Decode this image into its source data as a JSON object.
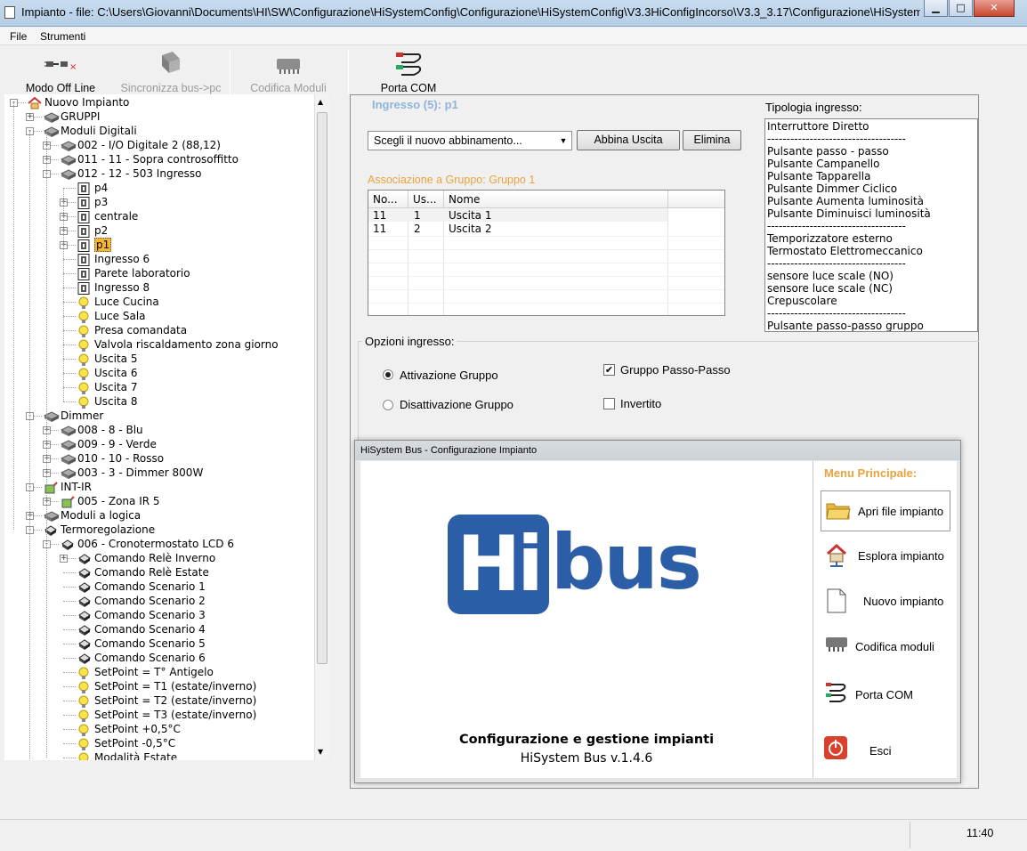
{
  "window": {
    "title": "Impianto - file: C:\\Users\\Giovanni\\Documents\\HI\\SW\\Configurazione\\HiSystemConfig\\Configurazione\\HiSystemConfig\\V3.3HiConfigIncorso\\V3.3_3.17\\Configurazione\\HiSystem"
  },
  "menu": {
    "file": "File",
    "strumenti": "Strumenti"
  },
  "toolbar": {
    "offline": "Modo Off Line",
    "sync": "Sincronizza bus->pc",
    "codifica": "Codifica Moduli",
    "porta": "Porta COM"
  },
  "tree": [
    {
      "label": "Nuovo Impianto",
      "depth": 0,
      "exp": "-",
      "icon": "house-icon"
    },
    {
      "label": "GRUPPI",
      "depth": 1,
      "exp": "+",
      "icon": "module-icon"
    },
    {
      "label": "Moduli Digitali",
      "depth": 1,
      "exp": "-",
      "icon": "module-icon"
    },
    {
      "label": "002 - I/O Digitale 2 (88,12)",
      "depth": 2,
      "exp": "+",
      "icon": "module-icon"
    },
    {
      "label": "011 - 11 - Sopra controsoffitto",
      "depth": 2,
      "exp": "+",
      "icon": "module-icon"
    },
    {
      "label": "012 - 12 - 503 Ingresso",
      "depth": 2,
      "exp": "-",
      "icon": "module-icon"
    },
    {
      "label": "p4",
      "depth": 3,
      "exp": "",
      "icon": "input-icon"
    },
    {
      "label": "p3",
      "depth": 3,
      "exp": "+",
      "icon": "input-icon"
    },
    {
      "label": "centrale",
      "depth": 3,
      "exp": "+",
      "icon": "input-icon"
    },
    {
      "label": "p2",
      "depth": 3,
      "exp": "+",
      "icon": "input-icon"
    },
    {
      "label": "p1",
      "depth": 3,
      "exp": "+",
      "icon": "input-icon",
      "selected": true
    },
    {
      "label": "Ingresso 6",
      "depth": 3,
      "exp": "",
      "icon": "input-icon"
    },
    {
      "label": "Parete laboratorio",
      "depth": 3,
      "exp": "",
      "icon": "input-icon"
    },
    {
      "label": "Ingresso 8",
      "depth": 3,
      "exp": "",
      "icon": "input-icon"
    },
    {
      "label": "Luce Cucina",
      "depth": 3,
      "exp": "",
      "icon": "bulb-icon"
    },
    {
      "label": "Luce Sala",
      "depth": 3,
      "exp": "",
      "icon": "bulb-icon"
    },
    {
      "label": "Presa comandata",
      "depth": 3,
      "exp": "",
      "icon": "bulb-icon"
    },
    {
      "label": "Valvola riscaldamento zona giorno",
      "depth": 3,
      "exp": "",
      "icon": "bulb-icon"
    },
    {
      "label": "Uscita 5",
      "depth": 3,
      "exp": "",
      "icon": "bulb-icon"
    },
    {
      "label": "Uscita 6",
      "depth": 3,
      "exp": "",
      "icon": "bulb-icon"
    },
    {
      "label": "Uscita 7",
      "depth": 3,
      "exp": "",
      "icon": "bulb-icon"
    },
    {
      "label": "Uscita 8",
      "depth": 3,
      "exp": "",
      "icon": "bulb-icon"
    },
    {
      "label": "Dimmer",
      "depth": 1,
      "exp": "-",
      "icon": "module-icon"
    },
    {
      "label": "008 - 8 - Blu",
      "depth": 2,
      "exp": "+",
      "icon": "module-icon"
    },
    {
      "label": "009 - 9 - Verde",
      "depth": 2,
      "exp": "+",
      "icon": "module-icon"
    },
    {
      "label": "010 - 10 - Rosso",
      "depth": 2,
      "exp": "+",
      "icon": "module-icon"
    },
    {
      "label": "003 - 3 - Dimmer 800W",
      "depth": 2,
      "exp": "+",
      "icon": "module-icon"
    },
    {
      "label": "INT-IR",
      "depth": 1,
      "exp": "-",
      "icon": "ir-icon"
    },
    {
      "label": "005 - Zona IR 5",
      "depth": 2,
      "exp": "+",
      "icon": "ir-icon"
    },
    {
      "label": "Moduli a logica",
      "depth": 1,
      "exp": "+",
      "icon": "module-icon"
    },
    {
      "label": "Termoregolazione",
      "depth": 1,
      "exp": "-",
      "icon": "thermo-icon"
    },
    {
      "label": "006 - Cronotermostato LCD 6",
      "depth": 2,
      "exp": "-",
      "icon": "thermo-icon"
    },
    {
      "label": "Comando Relè Inverno",
      "depth": 3,
      "exp": "+",
      "icon": "thermo-icon"
    },
    {
      "label": "Comando Relè Estate",
      "depth": 3,
      "exp": "",
      "icon": "thermo-icon"
    },
    {
      "label": "Comando Scenario 1",
      "depth": 3,
      "exp": "",
      "icon": "thermo-icon"
    },
    {
      "label": "Comando Scenario 2",
      "depth": 3,
      "exp": "",
      "icon": "thermo-icon"
    },
    {
      "label": "Comando Scenario 3",
      "depth": 3,
      "exp": "",
      "icon": "thermo-icon"
    },
    {
      "label": "Comando Scenario 4",
      "depth": 3,
      "exp": "",
      "icon": "thermo-icon"
    },
    {
      "label": "Comando Scenario 5",
      "depth": 3,
      "exp": "",
      "icon": "thermo-icon"
    },
    {
      "label": "Comando Scenario 6",
      "depth": 3,
      "exp": "",
      "icon": "thermo-icon"
    },
    {
      "label": "SetPoint = T° Antigelo",
      "depth": 3,
      "exp": "",
      "icon": "bulb-icon"
    },
    {
      "label": "SetPoint = T1 (estate/inverno)",
      "depth": 3,
      "exp": "",
      "icon": "bulb-icon"
    },
    {
      "label": "SetPoint = T2 (estate/inverno)",
      "depth": 3,
      "exp": "",
      "icon": "bulb-icon"
    },
    {
      "label": "SetPoint = T3 (estate/inverno)",
      "depth": 3,
      "exp": "",
      "icon": "bulb-icon"
    },
    {
      "label": "SetPoint +0,5°C",
      "depth": 3,
      "exp": "",
      "icon": "bulb-icon"
    },
    {
      "label": "SetPoint -0,5°C",
      "depth": 3,
      "exp": "",
      "icon": "bulb-icon"
    },
    {
      "label": "Modalità Estate",
      "depth": 3,
      "exp": "",
      "icon": "bulb-icon"
    }
  ],
  "panel": {
    "heading": "Ingresso (5): p1",
    "combo": "Scegli il nuovo abbinamento...",
    "abbina": "Abbina Uscita",
    "elimina": "Elimina",
    "assoc": "Associazione a Gruppo: Gruppo 1",
    "columns": [
      "No...",
      "Us...",
      "Nome"
    ],
    "rows": [
      [
        "11",
        "1",
        "Uscita 1"
      ],
      [
        "11",
        "2",
        "Uscita 2"
      ]
    ],
    "tipologia_label": "Tipologia ingresso:",
    "tipologia": [
      "Interruttore Diretto",
      "------------------------------------",
      "Pulsante passo - passo",
      "Pulsante Campanello",
      "Pulsante Tapparella",
      "Pulsante Dimmer Ciclico",
      "Pulsante Aumenta luminosità",
      "Pulsante Diminuisci luminosità",
      "------------------------------------",
      "Temporizzatore esterno",
      "Termostato Elettromeccanico",
      "------------------------------------",
      "sensore luce scale (NO)",
      "sensore luce scale (NC)",
      "Crepuscolare",
      "------------------------------------",
      "Pulsante passo-passo gruppo"
    ],
    "opzioni": "Opzioni ingresso:",
    "attivazione": "Attivazione Gruppo",
    "disattivazione": "Disattivazione Gruppo",
    "passo": "Gruppo Passo-Passo",
    "invertito": "Invertito"
  },
  "splash": {
    "title": "HiSystem Bus - Configurazione Impianto",
    "logo_hi": "Hi",
    "logo_bus": "bus",
    "line1": "Configurazione e gestione impianti",
    "line2": "HiSystem Bus v.1.4.6",
    "menu_title": "Menu Principale:",
    "items": [
      "Apri file impianto",
      "Esplora impianto",
      "Nuovo impianto",
      "Codifica moduli",
      "Porta COM",
      "Esci"
    ],
    "brand_color": "#2b5ea7"
  },
  "status": {
    "time": "11:40"
  },
  "colors": {
    "accent_gold": "#e8a33d",
    "heading_blue": "#8eb4dc",
    "selection": "#f5b731"
  }
}
